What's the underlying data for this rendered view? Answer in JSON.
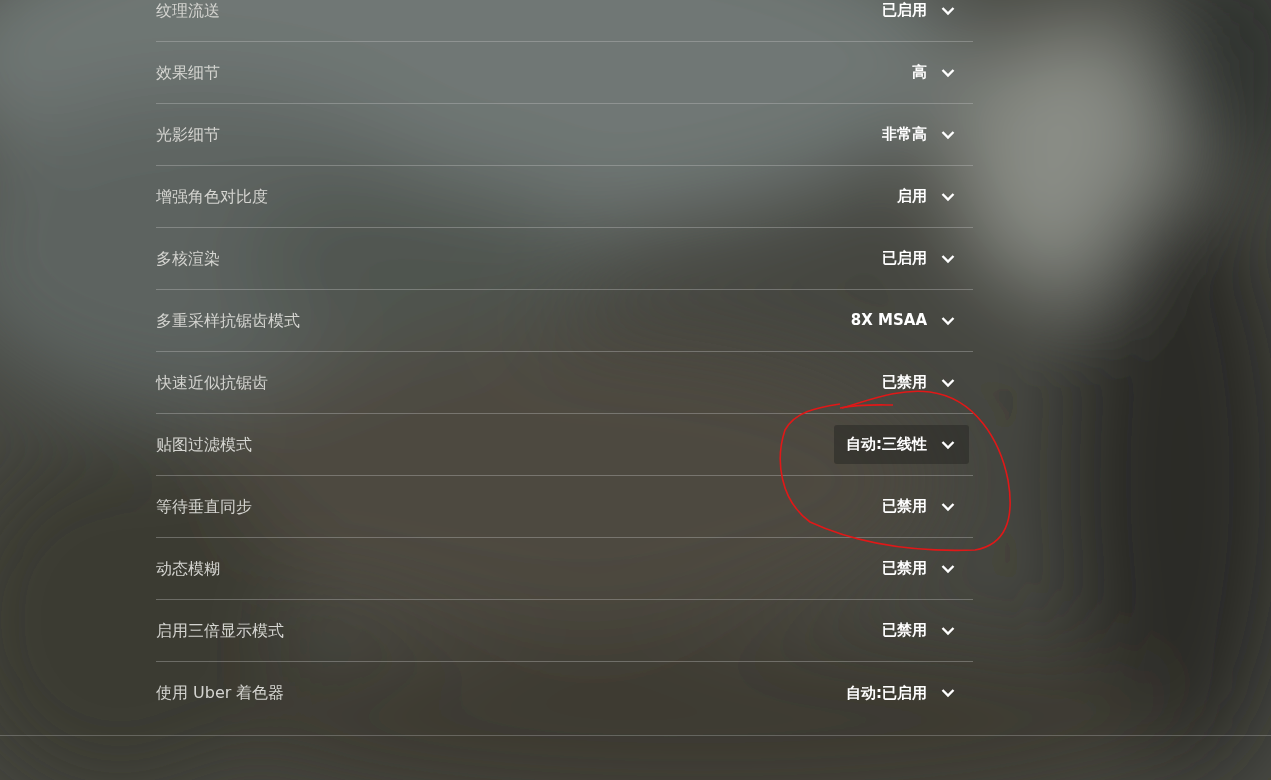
{
  "settings": [
    {
      "label": "纹理流送",
      "value": "已启用",
      "highlighted": false
    },
    {
      "label": "效果细节",
      "value": "高",
      "highlighted": false
    },
    {
      "label": "光影细节",
      "value": "非常高",
      "highlighted": false
    },
    {
      "label": "增强角色对比度",
      "value": "启用",
      "highlighted": false
    },
    {
      "label": "多核渲染",
      "value": "已启用",
      "highlighted": false
    },
    {
      "label": "多重采样抗锯齿模式",
      "value": "8X MSAA",
      "highlighted": false
    },
    {
      "label": "快速近似抗锯齿",
      "value": "已禁用",
      "highlighted": false
    },
    {
      "label": "贴图过滤模式",
      "value": "自动:三线性",
      "highlighted": true
    },
    {
      "label": "等待垂直同步",
      "value": "已禁用",
      "highlighted": false
    },
    {
      "label": "动态模糊",
      "value": "已禁用",
      "highlighted": false
    },
    {
      "label": "启用三倍显示模式",
      "value": "已禁用",
      "highlighted": false
    },
    {
      "label": "使用 Uber 着色器",
      "value": "自动:已启用",
      "highlighted": false
    }
  ],
  "annotations": [
    {
      "kind": "freehand-circle"
    }
  ]
}
